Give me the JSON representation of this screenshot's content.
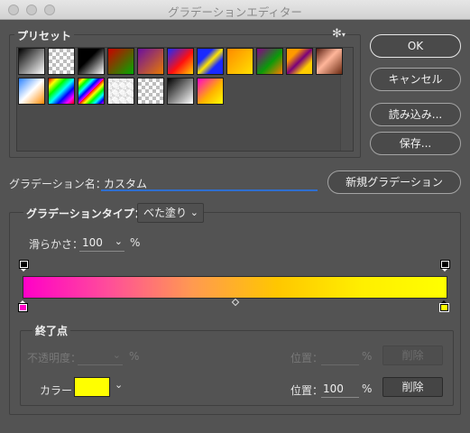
{
  "window": {
    "title": "グラデーションエディター"
  },
  "presets": {
    "label": "プリセット",
    "gear_icon": "gear-icon",
    "swatches_row1": [
      "linear-gradient(135deg,#000 0%,#fff 100%)",
      "checker-bw",
      "linear-gradient(135deg,#000 0%,#000 40%,#fff 100%)",
      "linear-gradient(135deg,#c00 0%,#0a0 100%)",
      "linear-gradient(135deg,#6a0fa0 0%,#e87a00 100%)",
      "linear-gradient(135deg,#1a2aff 0%,#ff1010 55%,#ffd000 100%)",
      "linear-gradient(135deg,#1a2aff 0%,#1a2aff 30%,#ffe600 50%,#1a2aff 70%)",
      "linear-gradient(135deg,#ff8a00 0%,#ffe100 100%)",
      "linear-gradient(135deg,#8a008a 0%,#0a9a0a 55%,#ff7a00 100%)",
      "linear-gradient(135deg,#ff9a00 0%,#ff9a00 25%,#7a007a 50%,#ffcc00 75%)",
      "linear-gradient(135deg,#5a1f12 0%,#ffb69a 45%,#6a2a12 100%)"
    ],
    "swatches_row2": [
      "linear-gradient(135deg,#2a82ff 0%,#fff 50%,#ff8a00 100%)",
      "linear-gradient(135deg,#f00 0%,#ff0 17%,#0f0 34%,#0ff 51%,#00f 68%,#f0f 85%,#f00 100%)",
      "repeating-linear-gradient(135deg,#f00 0px,#ff0 4px,#0f0 8px,#0ff 12px,#00f 16px,#f0f 20px)",
      "checker-rainbow",
      "checker-bw",
      "linear-gradient(135deg,#000 0%,#fff 100%)",
      "linear-gradient(135deg,#ff00d0 0%,#ffb000 55%,#ffff00 100%)"
    ]
  },
  "buttons": {
    "ok": "OK",
    "cancel": "キャンセル",
    "load": "読み込み...",
    "save": "保存...",
    "new_gradient": "新規グラデーション"
  },
  "name_field": {
    "label": "グラデーション名：",
    "value": "カスタム"
  },
  "gradient_type": {
    "label": "グラデーションタイプ：",
    "selected": "べた塗り",
    "smoothness_label": "滑らかさ：",
    "smoothness_value": "100",
    "smoothness_unit": "%"
  },
  "gradient_bar": {
    "colors": [
      "#ff00c8",
      "#ff4d9a",
      "#ff9a50",
      "#ffc700",
      "#ffef00",
      "#ffff00"
    ]
  },
  "stops": {
    "group_label": "終了点",
    "opacity_label": "不透明度：",
    "opacity_unit": "%",
    "opacity_location_label": "位置：",
    "opacity_location_unit": "%",
    "opacity_delete": "削除",
    "color_label": "カラー：",
    "color_value": "#ffff00",
    "color_location_label": "位置：",
    "color_location_value": "100",
    "color_location_unit": "%",
    "color_delete": "削除"
  }
}
